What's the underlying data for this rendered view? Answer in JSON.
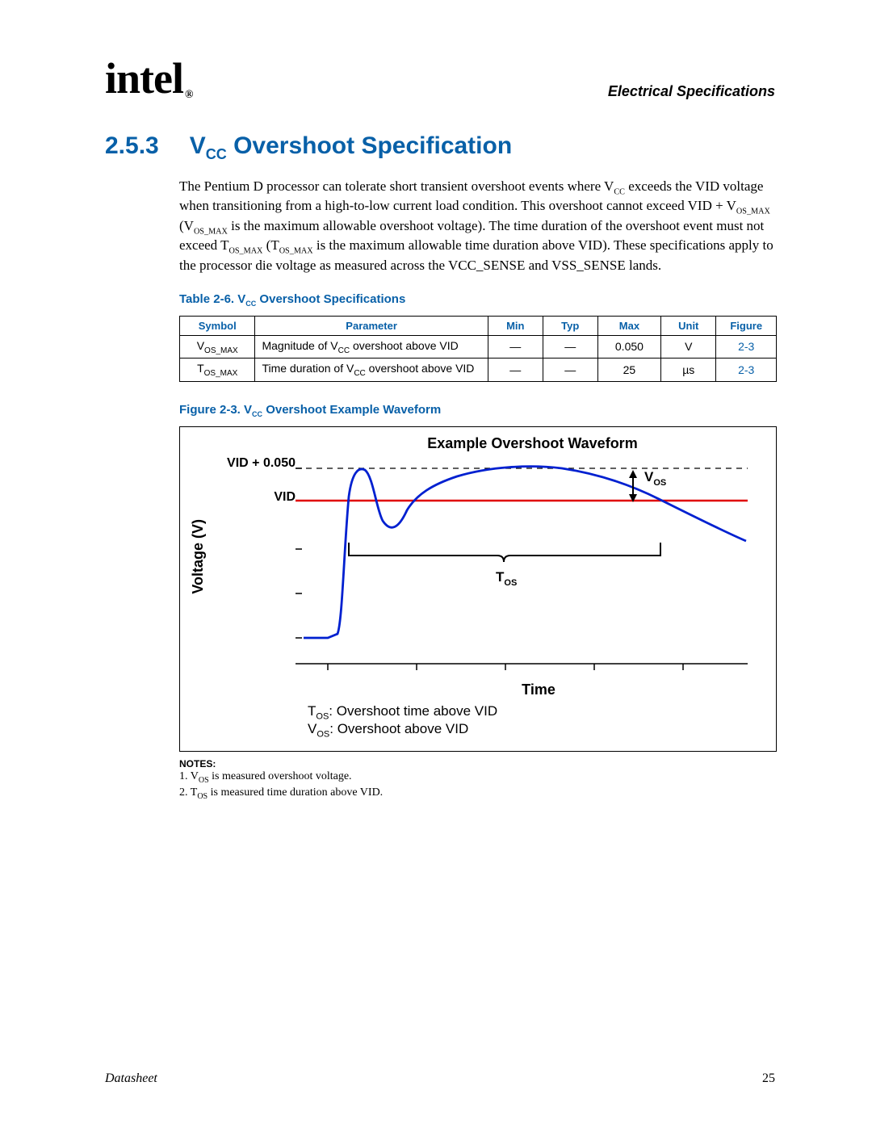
{
  "header": {
    "logo_text": "intel",
    "reg_mark": "®",
    "section_title": "Electrical Specifications"
  },
  "section": {
    "number": "2.5.3",
    "title_pre": "V",
    "title_sub": "CC",
    "title_post": " Overshoot Specification"
  },
  "body_paragraph": "The Pentium D processor can tolerate short transient overshoot events where VCC exceeds the VID voltage when transitioning from a high-to-low current load condition. This overshoot cannot exceed VID + VOS_MAX (VOS_MAX is the maximum allowable overshoot voltage). The time duration of the overshoot event must not exceed TOS_MAX (TOS_MAX is the maximum allowable time duration above VID). These specifications apply to the processor die voltage as measured across the VCC_SENSE and VSS_SENSE lands.",
  "table_caption": {
    "pre": "Table 2-6. V",
    "sub": "CC",
    "post": " Overshoot Specifications"
  },
  "table": {
    "headers": [
      "Symbol",
      "Parameter",
      "Min",
      "Typ",
      "Max",
      "Unit",
      "Figure"
    ],
    "rows": [
      {
        "symbol_pre": "V",
        "symbol_sub": "OS_MAX",
        "param_pre": "Magnitude of V",
        "param_sub": "CC",
        "param_post": " overshoot above VID",
        "min": "—",
        "typ": "—",
        "max": "0.050",
        "unit": "V",
        "figure": "2-3"
      },
      {
        "symbol_pre": "T",
        "symbol_sub": "OS_MAX",
        "param_pre": "Time duration of V",
        "param_sub": "CC",
        "param_post": " overshoot above VID",
        "min": "—",
        "typ": "—",
        "max": "25",
        "unit": "µs",
        "figure": "2-3"
      }
    ]
  },
  "figure_caption": {
    "pre": "Figure 2-3. V",
    "sub": "CC",
    "post": " Overshoot Example Waveform"
  },
  "chart": {
    "title": "Example Overshoot Waveform",
    "ylabel": "Voltage (V)",
    "xlabel": "Time",
    "yticks": [
      "VID + 0.050",
      "VID"
    ],
    "annotations": {
      "vos_label_pre": "V",
      "vos_label_sub": "OS",
      "tos_label_pre": "T",
      "tos_label_sub": "OS"
    },
    "legend": {
      "line1_pre": "T",
      "line1_sub": "OS",
      "line1_post": ": Overshoot time above VID",
      "line2_pre": "V",
      "line2_sub": "OS",
      "line2_post": ": Overshoot above VID"
    }
  },
  "chart_data": {
    "type": "line",
    "title": "Example Overshoot Waveform",
    "xlabel": "Time",
    "ylabel": "Voltage (V)",
    "reference_lines": [
      {
        "name": "VID + 0.050",
        "value": 0.05
      },
      {
        "name": "VID",
        "value": 0.0
      }
    ],
    "annotations": [
      {
        "name": "V_OS",
        "desc": "vertical span between waveform peak and VID line near peak"
      },
      {
        "name": "T_OS",
        "desc": "horizontal span where waveform stays above VID line"
      }
    ],
    "series": [
      {
        "name": "Vcc waveform (relative to VID, volts)",
        "x": [
          0.0,
          0.05,
          0.08,
          0.1,
          0.12,
          0.15,
          0.18,
          0.22,
          0.26,
          0.3,
          0.38,
          0.46,
          0.55,
          0.65,
          0.75,
          0.85,
          0.95,
          1.0
        ],
        "y": [
          -0.17,
          -0.168,
          -0.16,
          -0.1,
          0.04,
          0.044,
          0.0,
          -0.03,
          -0.01,
          0.02,
          0.042,
          0.05,
          0.049,
          0.042,
          0.028,
          0.005,
          -0.025,
          -0.045
        ]
      }
    ],
    "ylim": [
      -0.18,
      0.06
    ],
    "xlim": [
      0,
      1
    ]
  },
  "notes": {
    "heading": "NOTES:",
    "items": [
      {
        "pre": "1. V",
        "sub": "OS",
        "post": " is measured overshoot voltage."
      },
      {
        "pre": "2. T",
        "sub": "OS",
        "post": " is measured time duration above VID."
      }
    ]
  },
  "footer": {
    "left": "Datasheet",
    "page": "25"
  }
}
